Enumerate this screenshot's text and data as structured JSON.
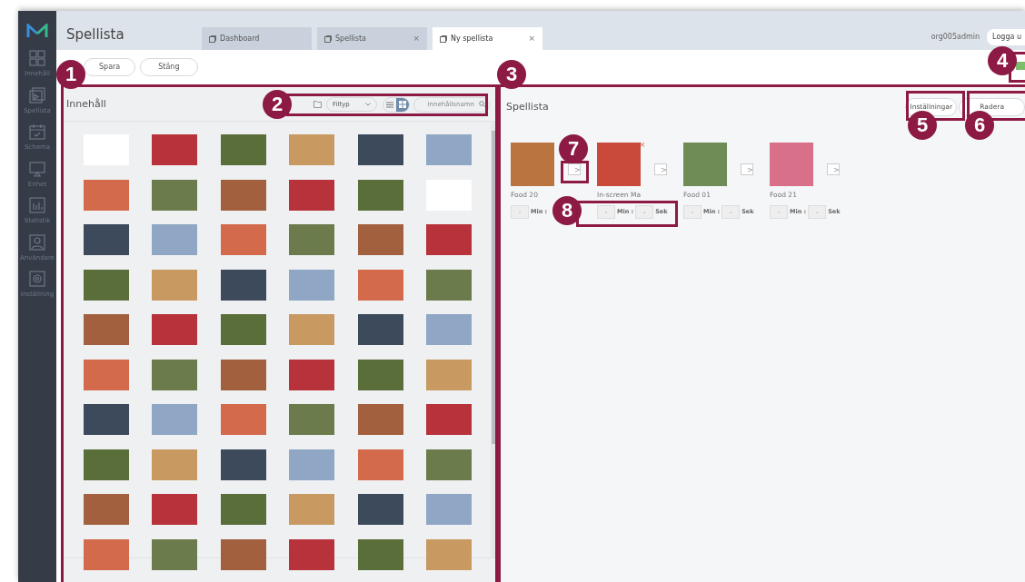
{
  "sidebar": {
    "items": [
      {
        "label": "Innehåll"
      },
      {
        "label": "Spellista"
      },
      {
        "label": "Schema"
      },
      {
        "label": "Enhet"
      },
      {
        "label": "Statistik"
      },
      {
        "label": "Användare"
      },
      {
        "label": "Inställning"
      }
    ]
  },
  "header": {
    "title": "Spellista",
    "tabs": [
      {
        "label": "Dashboard",
        "selected": false,
        "closable": false
      },
      {
        "label": "Spellista",
        "selected": false,
        "closable": true
      },
      {
        "label": "Ny spellista",
        "selected": true,
        "closable": true
      }
    ],
    "close_glyph": "×",
    "user": "org005admin",
    "logout": "Logga u"
  },
  "toolbar": {
    "buttons": [
      "Spara",
      "Stäng"
    ]
  },
  "content_panel": {
    "title": "Innehåll",
    "filter": {
      "value": "Filtyp"
    },
    "view_toggle": [
      {
        "selected": false
      },
      {
        "selected": true
      }
    ],
    "search": {
      "placeholder": "Innehållsnamn"
    },
    "thumbnails": [
      {
        "kind": "blank"
      },
      {
        "kind": "photo"
      },
      {
        "kind": "photo"
      },
      {
        "kind": "photo"
      },
      {
        "kind": "photo"
      },
      {
        "kind": "photo"
      },
      {
        "kind": "photo"
      },
      {
        "kind": "photo"
      },
      {
        "kind": "photo"
      },
      {
        "kind": "photo"
      },
      {
        "kind": "photo"
      },
      {
        "kind": "blank"
      },
      {
        "kind": "photo"
      },
      {
        "kind": "photo"
      },
      {
        "kind": "photo"
      },
      {
        "kind": "photo"
      },
      {
        "kind": "photo"
      },
      {
        "kind": "photo"
      },
      {
        "kind": "photo"
      },
      {
        "kind": "photo"
      },
      {
        "kind": "photo"
      },
      {
        "kind": "photo"
      },
      {
        "kind": "photo"
      },
      {
        "kind": "photo"
      },
      {
        "kind": "photo"
      },
      {
        "kind": "photo"
      },
      {
        "kind": "photo"
      },
      {
        "kind": "photo"
      },
      {
        "kind": "photo"
      },
      {
        "kind": "photo"
      },
      {
        "kind": "photo"
      },
      {
        "kind": "photo"
      },
      {
        "kind": "photo"
      },
      {
        "kind": "photo"
      },
      {
        "kind": "photo"
      },
      {
        "kind": "photo"
      },
      {
        "kind": "photo"
      },
      {
        "kind": "photo"
      },
      {
        "kind": "photo"
      },
      {
        "kind": "photo"
      },
      {
        "kind": "photo"
      },
      {
        "kind": "photo"
      },
      {
        "kind": "photo"
      },
      {
        "kind": "photo"
      },
      {
        "kind": "photo"
      },
      {
        "kind": "photo"
      },
      {
        "kind": "photo"
      },
      {
        "kind": "photo"
      },
      {
        "kind": "photo"
      },
      {
        "kind": "photo"
      },
      {
        "kind": "photo"
      },
      {
        "kind": "photo"
      },
      {
        "kind": "photo"
      },
      {
        "kind": "photo"
      },
      {
        "kind": "photo"
      },
      {
        "kind": "photo"
      },
      {
        "kind": "photo"
      },
      {
        "kind": "photo"
      },
      {
        "kind": "photo"
      },
      {
        "kind": "photo"
      }
    ]
  },
  "playlist_panel": {
    "title": "Spellista",
    "buttons": [
      "Inställningar",
      "Radera"
    ],
    "items": [
      {
        "name": "Food 20",
        "show_remove": false,
        "minutes": "-",
        "min_label": "Min :",
        "arrow": ">"
      },
      {
        "name": "In-screen Ma",
        "show_remove": true,
        "minutes": "-",
        "min_label": "Min :",
        "seconds": "-",
        "sec_label": "Sek",
        "arrow": ">"
      },
      {
        "name": "Food 01",
        "show_remove": false,
        "minutes": "-",
        "min_label": "Min :",
        "seconds": "-",
        "sec_label": "Sek",
        "arrow": ">"
      },
      {
        "name": "Food 21",
        "show_remove": false,
        "minutes": "-",
        "min_label": "Min :",
        "seconds": "-",
        "sec_label": "Sek",
        "arrow": ">"
      }
    ]
  },
  "annotations": [
    {
      "label": "1"
    },
    {
      "label": "2"
    },
    {
      "label": "3"
    },
    {
      "label": "4"
    },
    {
      "label": "5"
    },
    {
      "label": "6"
    },
    {
      "label": "7"
    },
    {
      "label": "8"
    }
  ]
}
